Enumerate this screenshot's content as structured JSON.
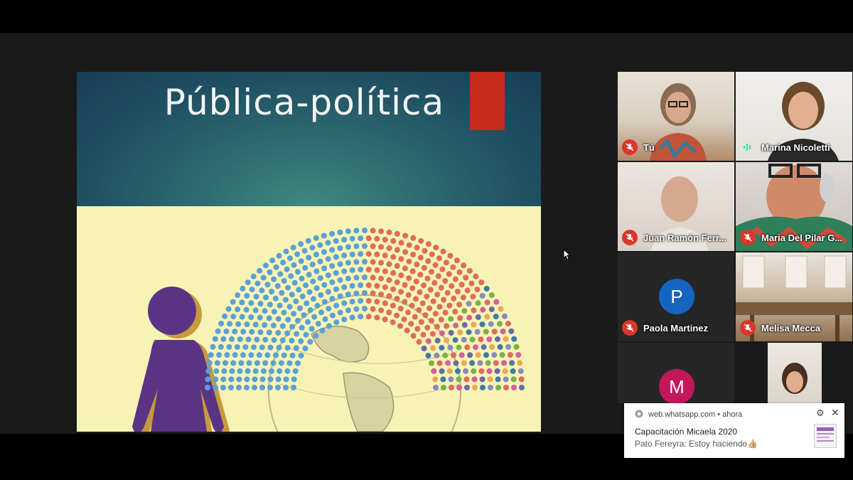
{
  "slide": {
    "title": "Pública-política"
  },
  "participants": [
    {
      "name": "Tú",
      "muted": true
    },
    {
      "name": "Marina Nicoletti",
      "muted": false
    },
    {
      "name": "Juan Ramón Ferr...",
      "muted": true
    },
    {
      "name": "Maria Del Pilar G...",
      "muted": true
    },
    {
      "name": "Paola Martinez",
      "muted": true,
      "initial": "P",
      "color": "#1565c0"
    },
    {
      "name": "Melisa Mecca",
      "muted": true
    },
    {
      "initial": "M",
      "color": "#c2185b"
    }
  ],
  "notification": {
    "source": "web.whatsapp.com",
    "time": "ahora",
    "title": "Capacitación Micaela 2020",
    "message": "Pato Fereyra: Estoy haciendo👍🏼"
  }
}
